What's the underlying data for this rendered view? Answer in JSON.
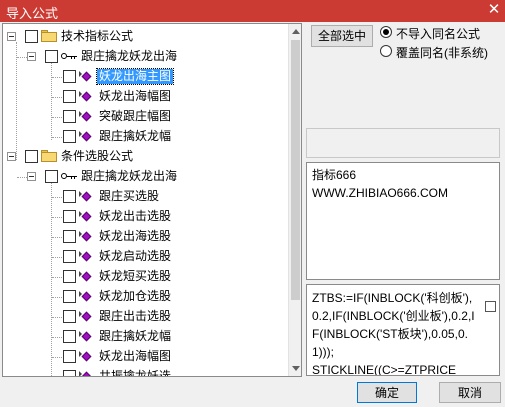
{
  "window": {
    "title": "导入公式",
    "close_glyph": "✕"
  },
  "tree": {
    "groups": [
      {
        "label": "技术指标公式",
        "indicator": "跟庄擒龙妖龙出海",
        "items": [
          "妖龙出海主图",
          "妖龙出海幅图",
          "突破跟庄幅图",
          "跟庄擒妖龙幅"
        ],
        "selected_item": "妖龙出海主图"
      },
      {
        "label": "条件选股公式",
        "indicator": "跟庄擒龙妖龙出海",
        "items": [
          "跟庄买选股",
          "妖龙出击选股",
          "妖龙出海选股",
          "妖龙启动选股",
          "妖龙短买选股",
          "妖龙加仓选股",
          "跟庄出击选股",
          "跟庄擒妖龙幅",
          "妖龙出海幅图",
          "共振擒龙妖选"
        ]
      }
    ]
  },
  "options": {
    "select_all_label": "全部选中",
    "radio_options": [
      "不导入同名公式",
      "覆盖同名(非系统)"
    ],
    "selected_radio": "不导入同名公式"
  },
  "info": {
    "lines": [
      "指标666",
      "WWW.ZHIBIAO666.COM"
    ]
  },
  "code": {
    "text": "ZTBS:=IF(INBLOCK('科创板'),0.2,IF(INBLOCK('创业板'),0.2,IF(INBLOCK('ST板块'),0.05,0.1)));\nSTICKLINE((C>=ZTPRICE"
  },
  "buttons": {
    "ok": "确定",
    "cancel": "取消"
  }
}
